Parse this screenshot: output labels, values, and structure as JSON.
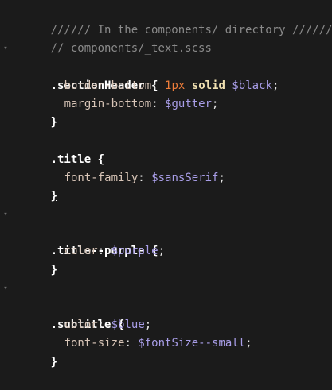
{
  "editor": {
    "lines": {
      "l1": {
        "text": "////// In the components/ directory //////"
      },
      "l2": {
        "text": "// components/_text.scss"
      },
      "l3": {
        "selector": ".sectionHeader",
        "brace": "{"
      },
      "l4": {
        "prop": "border-bottom",
        "colon": ":",
        "num": "1px",
        "kw": "solid",
        "var": "$black",
        "semi": ";"
      },
      "l5": {
        "prop": "margin-bottom",
        "colon": ":",
        "var": "$gutter",
        "semi": ";"
      },
      "l6": {
        "brace": "}"
      },
      "l8": {
        "selector": ".title",
        "brace": "{"
      },
      "l9": {
        "prop": "font-family",
        "colon": ":",
        "var": "$sansSerif",
        "semi": ";"
      },
      "l10": {
        "brace": "}"
      },
      "l12": {
        "selector": ".title--purple",
        "brace": "{"
      },
      "l13": {
        "prop": "color",
        "colon": ":",
        "var": "$purple",
        "semi": ";"
      },
      "l14": {
        "brace": "}"
      },
      "l16": {
        "selector": ".subtitle",
        "brace": "{"
      },
      "l17": {
        "prop": "color",
        "colon": ":",
        "var": "$blue",
        "semi": ";"
      },
      "l18": {
        "prop": "font-size",
        "colon": ":",
        "var": "$fontSize--small",
        "semi": ";"
      },
      "l19": {
        "brace": "}"
      }
    },
    "fold_glyph": "▾",
    "colors": {
      "background": "#1b1b1b",
      "comment": "#8a8a8a",
      "selector": "#ffffff",
      "property": "#d9c6b8",
      "number": "#ee7d3a",
      "keyword": "#f0e0b0",
      "variable": "#a99ee8"
    }
  }
}
